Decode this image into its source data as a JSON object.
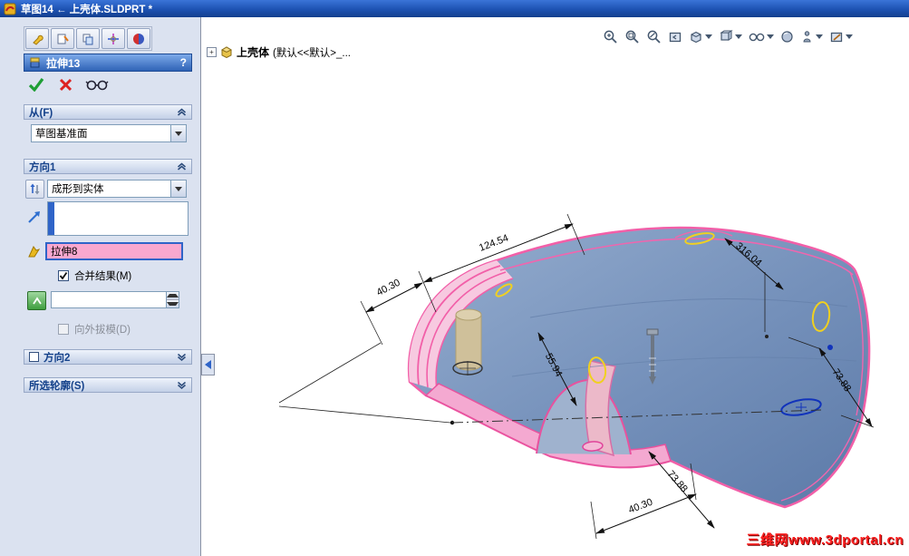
{
  "window": {
    "title": "草图14 ←  上壳体.SLDPRT *"
  },
  "pm": {
    "title": "拉伸13",
    "help": "?",
    "from": {
      "label": "从(F)",
      "value": "草图基准面"
    },
    "dir1": {
      "label": "方向1",
      "end_condition": "成形到实体",
      "selection_value": "",
      "body": "拉伸8",
      "merge_label": "合并结果(M)",
      "merge_checked": true,
      "draft_value": "",
      "draft_label": "向外拔模(D)",
      "draft_enabled": false
    },
    "dir2": {
      "label": "方向2",
      "checked": false
    },
    "contours": {
      "label": "所选轮廓(S)"
    }
  },
  "tree": {
    "part": "上壳体",
    "config": "(默认<<默认>_..."
  },
  "dims": [
    {
      "value": "124.54"
    },
    {
      "value": "40.30"
    },
    {
      "value": "316.04"
    },
    {
      "value": "55.94"
    },
    {
      "value": "73.88"
    },
    {
      "value": "73.88"
    },
    {
      "value": "40.30"
    }
  ],
  "watermark": {
    "text": "三维网www.3dportal.cn"
  },
  "icons": {
    "ok": "green-check",
    "cancel": "red-cross",
    "preview": "glasses",
    "reverse-direction": "double-arrow",
    "direction-arrow": "blue-diagonal-arrow",
    "body-pick": "yellow-flag",
    "draft": "green-draft-square",
    "view_toolbar": [
      "zoom-in",
      "zoom-area",
      "zoom-arrow",
      "zoom-fit",
      "standard-views",
      "section-view",
      "hide-show-items",
      "appearances",
      "lighting",
      "scene-edit"
    ]
  },
  "colors": {
    "selection_pink": "#f9a8cf",
    "edge_pink": "#f25fa8",
    "model_blue": "#7b96bc",
    "highlight_yellow": "#f0d020",
    "sketch_blue": "#1133bb"
  }
}
